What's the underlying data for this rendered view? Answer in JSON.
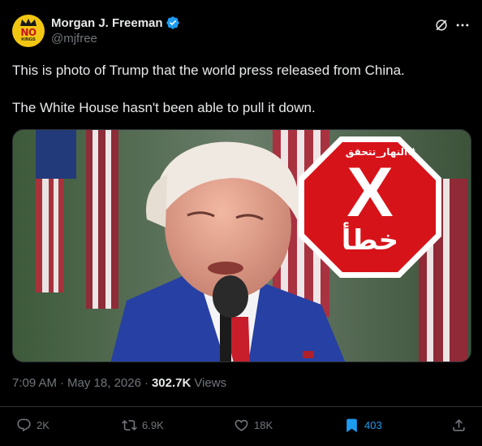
{
  "author": {
    "display_name": "Morgan J. Freeman",
    "handle": "@mjfree",
    "avatar": {
      "top_text": "NO",
      "bottom_text": "KINGS"
    }
  },
  "tweet": {
    "paragraphs": [
      "This is photo of Trump that the world press released from China.",
      "The White House hasn't been able to pull it down."
    ]
  },
  "media": {
    "overlay": {
      "hashtag": "#النهار_تتحقق",
      "symbol": "X",
      "word": "خطأ"
    }
  },
  "meta": {
    "time": "7:09 AM",
    "date": "May 18, 2026",
    "views_count": "302.7K",
    "views_label": "Views"
  },
  "actions": {
    "replies": "2K",
    "reposts": "6.9K",
    "likes": "18K",
    "bookmarks": "403"
  },
  "colors": {
    "background": "#000000",
    "text": "#e7e9ea",
    "muted": "#71767b",
    "accent": "#1d9bf0",
    "stop_red": "#d7131a"
  },
  "icons": [
    "verified-badge-icon",
    "grok-icon",
    "more-icon",
    "reply-icon",
    "repost-icon",
    "like-icon",
    "bookmark-icon",
    "share-icon"
  ]
}
